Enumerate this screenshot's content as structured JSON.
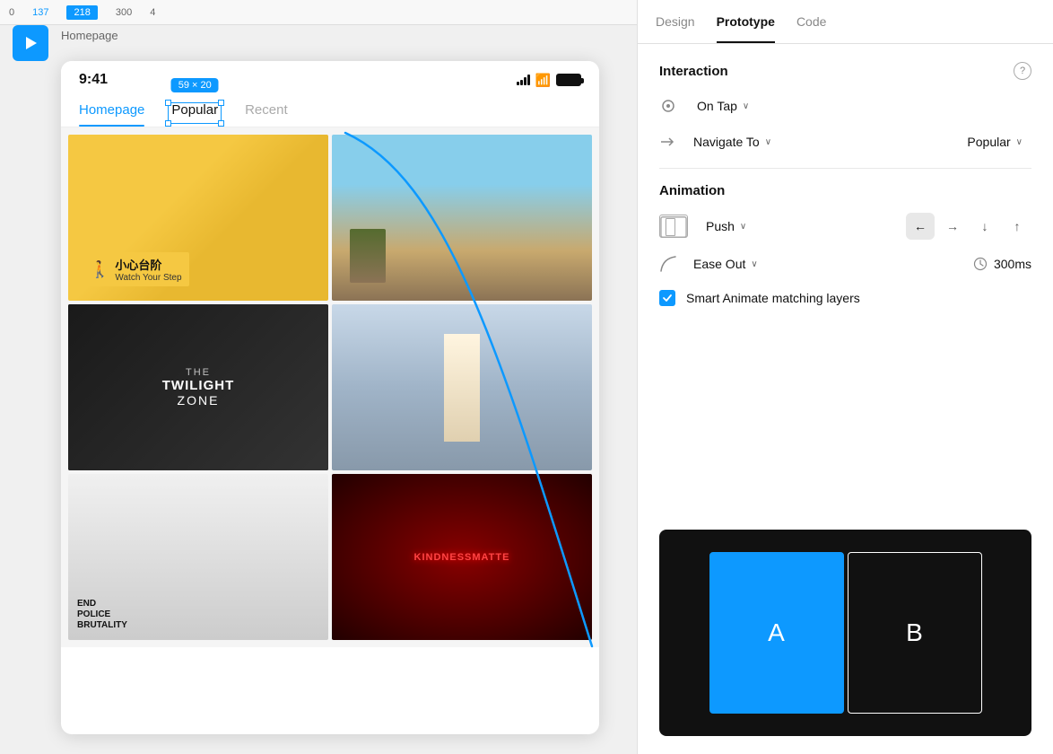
{
  "timeline": {
    "numbers": [
      "0",
      "137",
      "218",
      "300",
      "4"
    ]
  },
  "canvas": {
    "label": "Homepage"
  },
  "status_bar": {
    "time": "9:41"
  },
  "size_badge": "59 × 20",
  "tabs": [
    {
      "label": "Homepage",
      "active": true
    },
    {
      "label": "Popular",
      "active": false
    },
    {
      "label": "Recent",
      "active": false
    }
  ],
  "panel": {
    "tabs": [
      {
        "label": "Design",
        "active": false
      },
      {
        "label": "Prototype",
        "active": true
      },
      {
        "label": "Code",
        "active": false
      }
    ],
    "interaction": {
      "title": "Interaction",
      "trigger": "On Tap",
      "action": "Navigate To",
      "destination": "Popular"
    },
    "animation": {
      "title": "Animation",
      "type": "Push",
      "directions": [
        "←",
        "→",
        "↓",
        "↑"
      ],
      "active_direction": "←",
      "easing": "Ease Out",
      "timing": "300ms",
      "smart_animate": "Smart Animate matching layers"
    },
    "preview": {
      "slide_a": "A",
      "slide_b": "B"
    }
  },
  "icons": {
    "play": "▶",
    "chevron_down": "∨",
    "arrow_right": "→",
    "circle_trigger": "○",
    "help": "?",
    "check": "✓"
  }
}
